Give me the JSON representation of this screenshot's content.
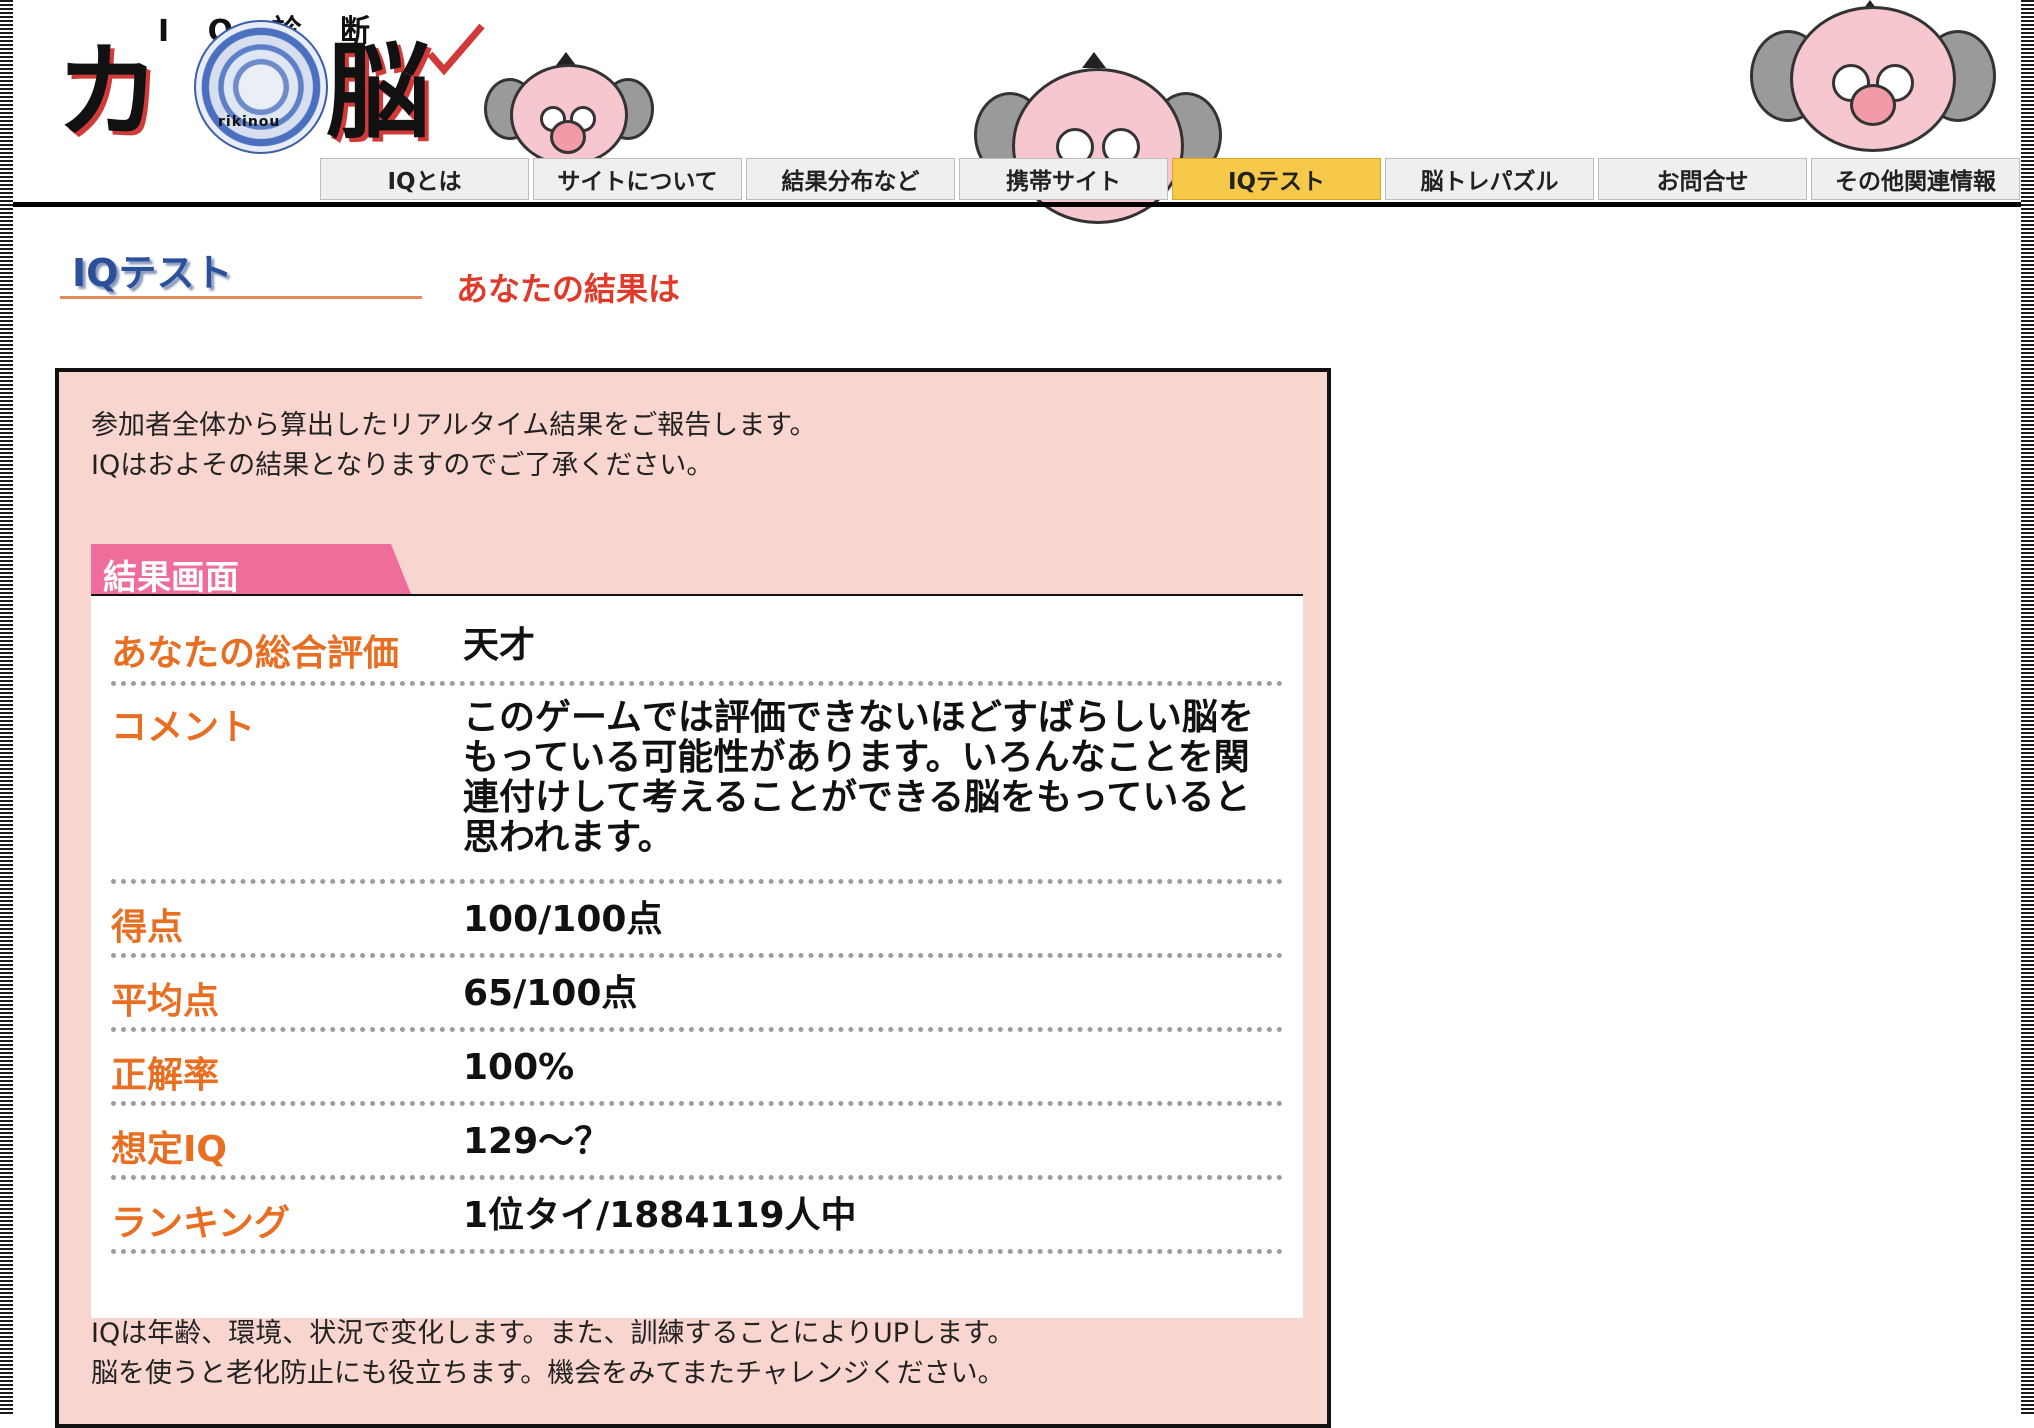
{
  "logo": {
    "subtitle": "I Q 診 断",
    "left_char": "カ",
    "right_char": "脳",
    "romaji": "rikinou"
  },
  "nav": {
    "items": [
      {
        "label": "IQとは",
        "active": false
      },
      {
        "label": "サイトについて",
        "active": false
      },
      {
        "label": "結果分布など",
        "active": false
      },
      {
        "label": "携帯サイト",
        "active": false
      },
      {
        "label": "IQテスト",
        "active": true
      },
      {
        "label": "脳トレパズル",
        "active": false
      },
      {
        "label": "お問合せ",
        "active": false
      },
      {
        "label": "その他関連情報",
        "active": false
      }
    ]
  },
  "section": {
    "tag": "IQテスト",
    "heading": "あなたの結果は"
  },
  "intro": {
    "line1": "参加者全体から算出したリアルタイム結果をご報告します。",
    "line2": "IQはおよその結果となりますのでご了承ください。"
  },
  "result": {
    "label": "結果画面",
    "rows": [
      {
        "label": "あなたの総合評価",
        "value": "天才"
      },
      {
        "label": "コメント",
        "value": "このゲームでは評価できないほどすばらしい脳をもっている可能性があります。いろんなことを関連付けして考えることができる脳をもっていると思われます。"
      },
      {
        "label": "得点",
        "value": "100/100点"
      },
      {
        "label": "平均点",
        "value": "65/100点"
      },
      {
        "label": "正解率",
        "value": "100%"
      },
      {
        "label": "想定IQ",
        "value": "129～？"
      },
      {
        "label": "ランキング",
        "value": "1位タイ/1884119人中"
      }
    ]
  },
  "footer": {
    "line1": "IQは年齢、環境、状況で変化します。また、訓練することによりUPします。",
    "line2": "脳を使うと老化防止にも役立ちます。機会をみてまたチャレンジください。"
  },
  "colors": {
    "accent_orange": "#e86f22",
    "heading_red": "#e03a2a",
    "nav_active": "#f6c94a",
    "result_bg": "#f9d5cf",
    "tag_pink": "#ee6d9a"
  },
  "icons": [
    "professor-mascot-icon",
    "brain-logo-icon",
    "checkmark-icon"
  ]
}
